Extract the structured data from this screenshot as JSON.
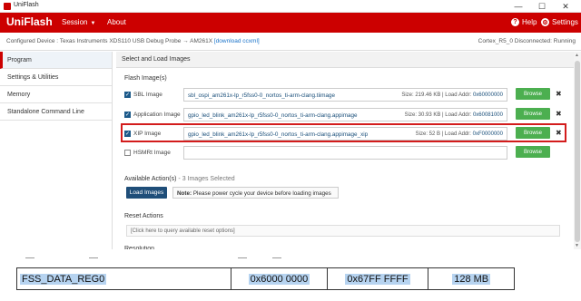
{
  "window": {
    "title": "UniFlash",
    "controls": {
      "minimize": "—",
      "maximize": "☐",
      "close": "✕"
    }
  },
  "menubar": {
    "brand": "UniFlash",
    "session": "Session",
    "about": "About",
    "help": "Help",
    "settings": "Settings",
    "accent_color": "#cc0000"
  },
  "breadcrumb": {
    "prefix": "Configured Device : Texas Instruments XDS110 USB Debug Probe",
    "arrow": "→",
    "device": "AM261X",
    "link": "[download ccxml]",
    "status": "Cortex_R5_0 Disconnected: Running"
  },
  "sidebar": {
    "items": [
      {
        "label": "Program"
      },
      {
        "label": "Settings & Utilities"
      },
      {
        "label": "Memory"
      },
      {
        "label": "Standalone Command Line"
      }
    ]
  },
  "main": {
    "header": "Select and Load Images",
    "flash_title": "Flash Image(s)",
    "images": [
      {
        "label": "SBL Image",
        "checked": true,
        "path": "sbl_ospi_am261x-lp_r5fss0-0_nortos_ti-arm-clang.tiimage",
        "size": "Size: 219.46 KB",
        "addr_label": "| Load Addr:",
        "addr": "0x60000000",
        "browse": "Browse",
        "remove": "✖"
      },
      {
        "label": "Application Image",
        "checked": true,
        "path": "gpio_led_blink_am261x-lp_r5fss0-0_nortos_ti-arm-clang.appimage",
        "size": "Size: 30.93 KB",
        "addr_label": "| Load Addr:",
        "addr": "0x60081000",
        "browse": "Browse",
        "remove": "✖"
      },
      {
        "label": "XIP Image",
        "checked": true,
        "path": "gpio_led_blink_am261x-lp_r5fss0-0_nortos_ti-arm-clang.appimage_xip",
        "size": "Size: 52 B",
        "addr_label": "| Load Addr:",
        "addr": "0xF0000000",
        "browse": "Browse",
        "remove": "✖"
      },
      {
        "label": "HSMRt Image",
        "checked": false,
        "path": "",
        "size": "",
        "addr_label": "",
        "addr": "",
        "browse": "Browse",
        "remove": ""
      }
    ],
    "actions_title": "Available Action(s)",
    "actions_sub": " - 3 Images Selected",
    "load_button": "Load Images",
    "note_bold": "Note:",
    "note_text": " Please power cycle your device before loading images",
    "reset_title": "Reset Actions",
    "reset_hint": "[Click here to query available reset options]",
    "cut_title": "Resolution"
  },
  "doc_table": {
    "region": "FSS_DATA_REG0",
    "start": "0x6000 0000",
    "end": "0x67FF FFFF",
    "size": "128 MB"
  }
}
